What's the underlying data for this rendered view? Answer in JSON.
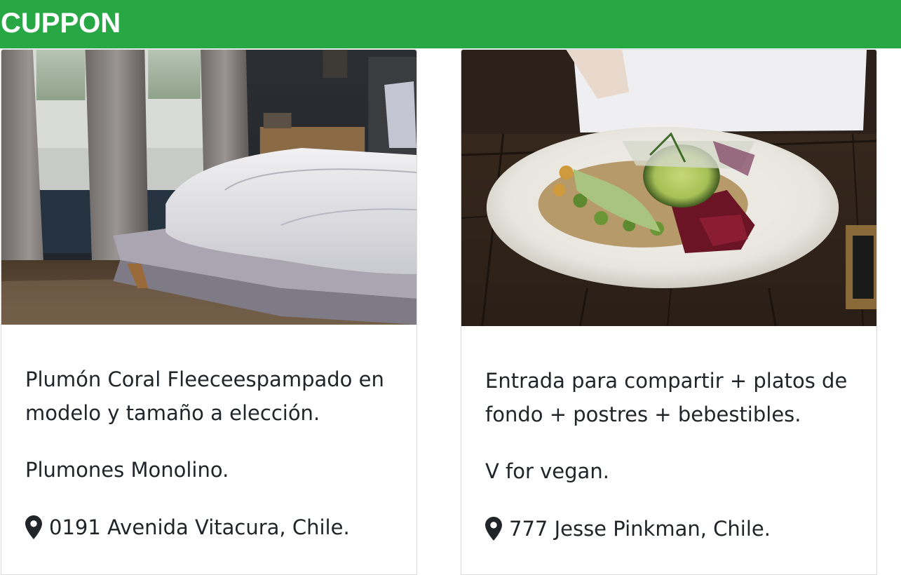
{
  "navbar": {
    "brand": "CUPPON",
    "color": "#28a745"
  },
  "cards": [
    {
      "image": "bedroom-photo",
      "description": "Plumón Coral Fleeceespampado en modelo y tamaño a elección.",
      "merchant": "Plumones Monolino.",
      "address": "0191 Avenida Vitacura, Chile.",
      "icon": "map-marker-icon"
    },
    {
      "image": "vegan-bowl-photo",
      "description": "Entrada para compartir + platos de fondo + postres + bebestibles.",
      "merchant": "V for vegan.",
      "address": "777 Jesse Pinkman, Chile.",
      "icon": "map-marker-icon"
    }
  ]
}
